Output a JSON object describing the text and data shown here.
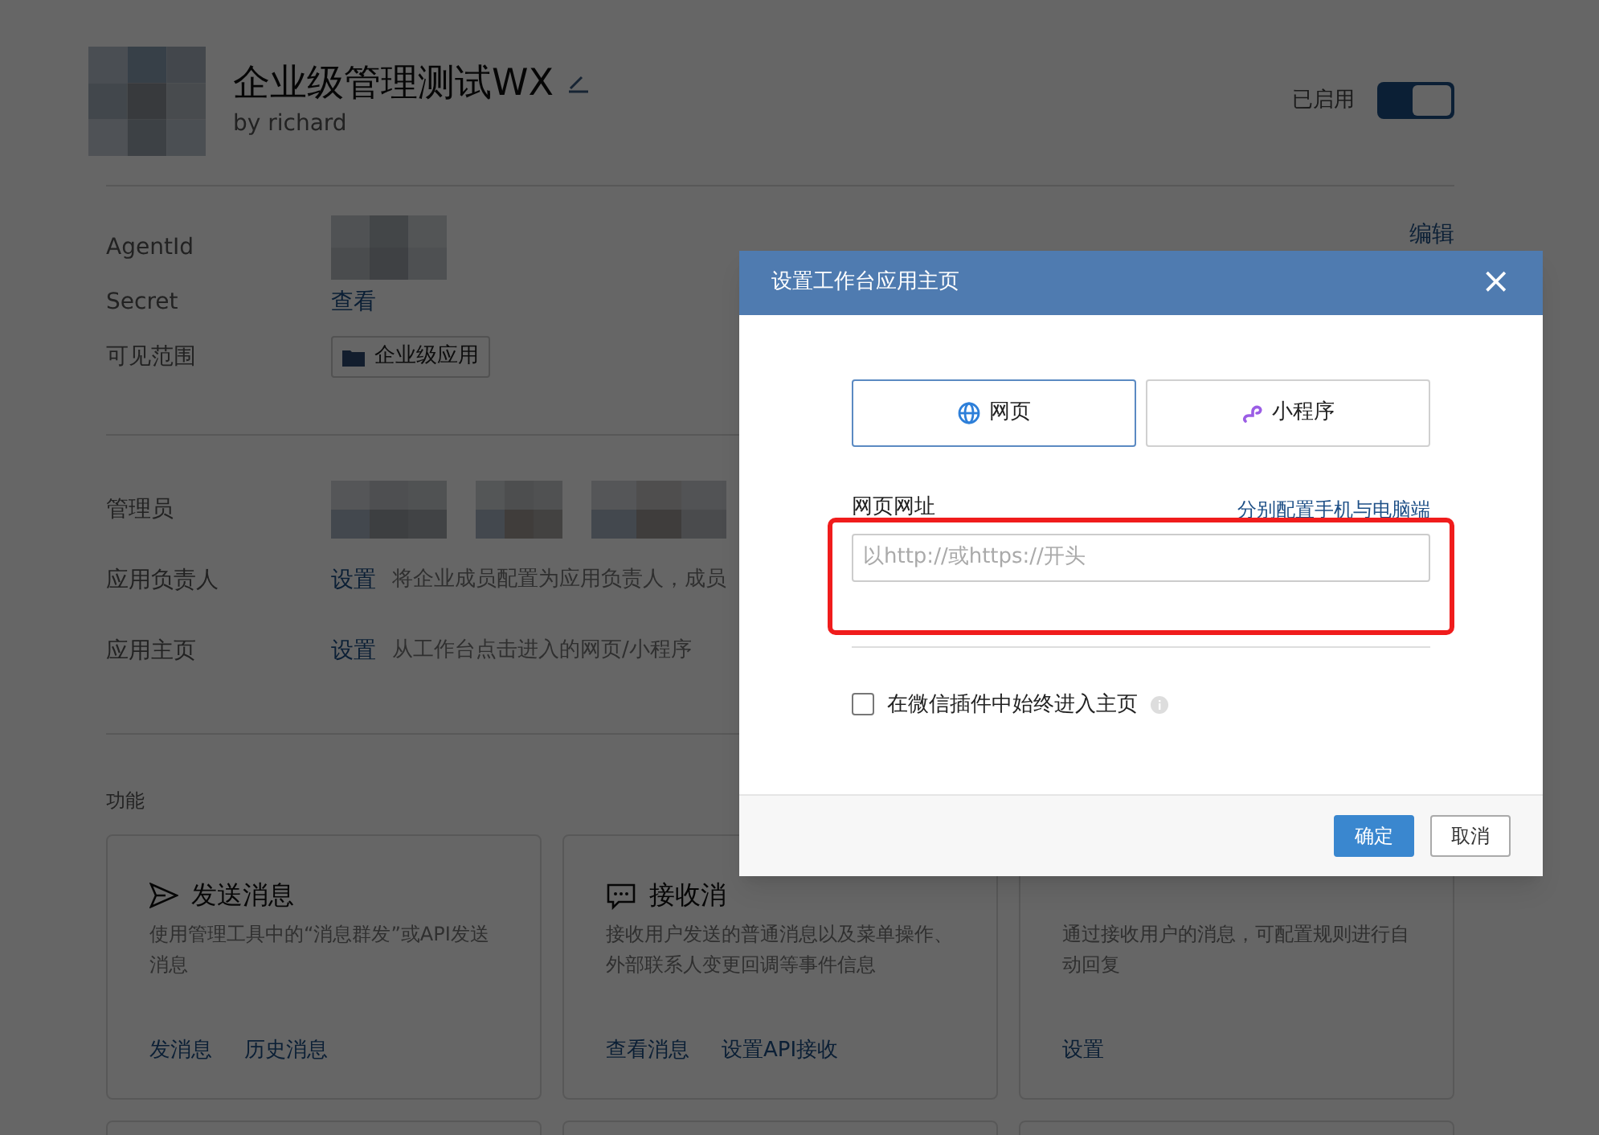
{
  "app": {
    "title": "企业级管理测试WX",
    "author": "by richard",
    "status_label": "已启用",
    "enabled": true
  },
  "info_rows": [
    {
      "label": "AgentId",
      "kind": "blurred"
    },
    {
      "label": "Secret",
      "kind": "link",
      "link": "查看"
    },
    {
      "label": "可见范围",
      "kind": "tag",
      "tag": "企业级应用"
    }
  ],
  "edit_link": "编辑",
  "role_rows": [
    {
      "label": "管理员",
      "kind": "avatars"
    },
    {
      "label": "应用负责人",
      "kind": "link",
      "link": "设置",
      "description": "将企业成员配置为应用负责人，成员"
    },
    {
      "label": "应用主页",
      "kind": "link",
      "link": "设置",
      "description": "从工作台点击进入的网页/小程序"
    }
  ],
  "features": {
    "heading": "功能",
    "cards": [
      {
        "title": "发送消息",
        "description": "使用管理工具中的“消息群发”或API发送消息",
        "links": [
          "发消息",
          "历史消息"
        ]
      },
      {
        "title": "接收消",
        "description": "接收用户发送的普通消息以及菜单操作、外部联系人变更回调等事件信息",
        "links": [
          "查看消息",
          "设置API接收"
        ]
      },
      {
        "description": "通过接收用户的消息，可配置规则进行自动回复",
        "links": [
          "设置"
        ]
      }
    ]
  },
  "dialog": {
    "title": "设置工作台应用主页",
    "close": "×",
    "tabs": [
      {
        "label": "网页",
        "selected": true
      },
      {
        "label": "小程序",
        "selected": false
      }
    ],
    "field_label": "网页网址",
    "field_link": "分别配置手机与电脑端",
    "placeholder": "以http://或https://开头",
    "checkbox": {
      "label": "在微信插件中始终进入主页",
      "checked": false
    },
    "buttons": [
      {
        "label": "确定",
        "kind": "primary"
      },
      {
        "label": "取消",
        "kind": "secondary"
      }
    ]
  }
}
